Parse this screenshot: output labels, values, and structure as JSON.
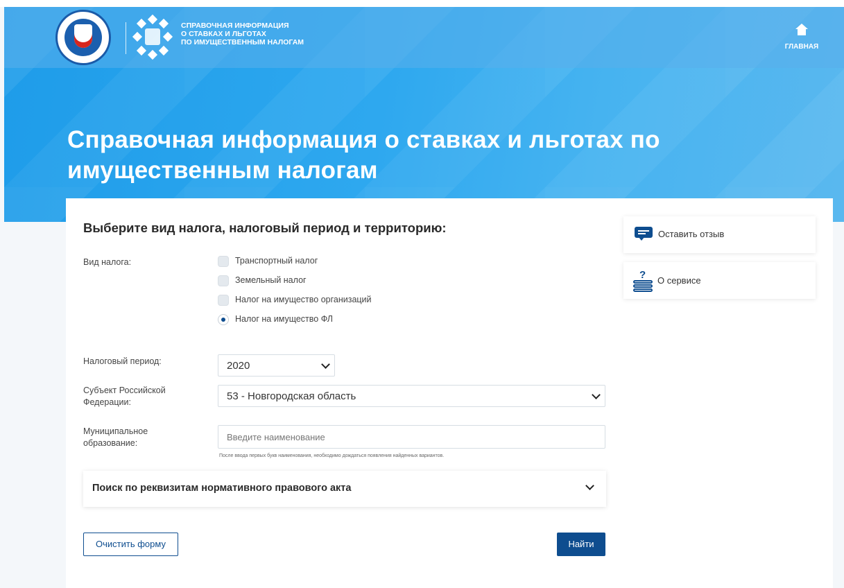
{
  "header": {
    "service_name_lines": [
      "Справочная информация",
      "о ставках и льготах",
      "по имущественным налогам"
    ],
    "home_label": "ГЛАВНАЯ",
    "logo_icon": "fns-emblem-icon",
    "service_icon": "service-logo-icon",
    "home_icon": "home-icon"
  },
  "hero": {
    "title_lines": [
      "Справочная информация о ставках и льготах по",
      "имущественным налогам"
    ]
  },
  "form": {
    "heading": "Выберите вид налога, налоговый период и территорию:",
    "tax_type_label": "Вид налога:",
    "tax_options": [
      {
        "label": "Транспортный налог",
        "selected": false
      },
      {
        "label": "Земельный налог",
        "selected": false
      },
      {
        "label": "Налог на имущество организаций",
        "selected": false
      },
      {
        "label": "Налог на имущество ФЛ",
        "selected": true
      }
    ],
    "period_label": "Налоговый период:",
    "period_value": "2020",
    "region_label": "Субъект Российской Федерации:",
    "region_value": "53 - Новгородская область",
    "municipality_label": "Муниципальное образование:",
    "municipality_placeholder": "Введите наименование",
    "municipality_hint": "После ввода первых букв наименования, необходимо дождаться появления найденных вариантов.",
    "accordion_title": "Поиск по реквизитам нормативного правового акта",
    "clear_button": "Очистить форму",
    "find_button": "Найти"
  },
  "sidebar": {
    "feedback_label": "Оставить отзыв",
    "feedback_icon": "feedback-bubble-icon",
    "about_label": "О сервисе",
    "about_icon": "books-question-icon"
  },
  "colors": {
    "accent": "#0e4d8f",
    "hero_blue": "#2ea8ef",
    "page_bg": "#f4f7fa"
  }
}
